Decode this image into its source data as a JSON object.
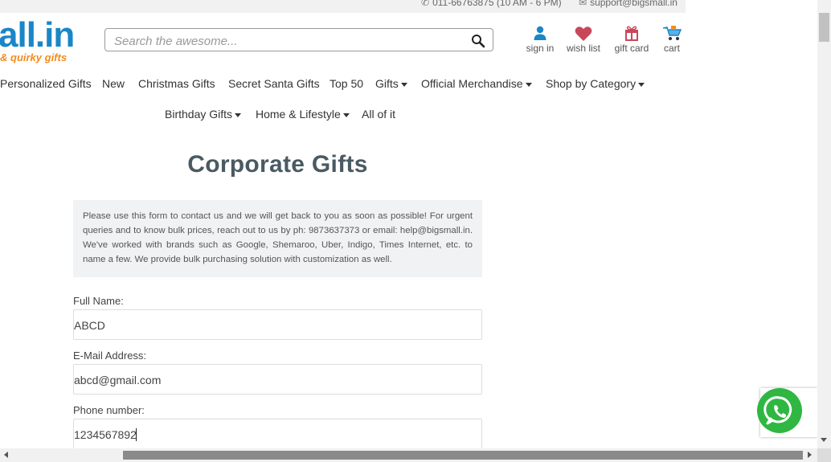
{
  "topbar": {
    "phone": "011-66763875 (10 AM - 6 PM)",
    "email": "support@bigsmall.in",
    "phone_icon": "phone-icon",
    "email_icon": "envelope-icon"
  },
  "logo": {
    "text": "all.in",
    "tagline": "& quirky gifts"
  },
  "search": {
    "placeholder": "Search the awesome...",
    "icon": "magnifier-icon"
  },
  "header_icons": [
    {
      "label": "sign in",
      "icon": "user-icon"
    },
    {
      "label": "wish list",
      "icon": "heart-icon"
    },
    {
      "label": "gift card",
      "icon": "gift-icon"
    },
    {
      "label": "cart",
      "icon": "cart-icon"
    }
  ],
  "nav": {
    "row1": [
      {
        "label": "Personalized Gifts"
      },
      {
        "label": "New"
      },
      {
        "label": "Christmas Gifts"
      },
      {
        "label": "Secret Santa Gifts"
      },
      {
        "label": "Top 50"
      },
      {
        "label": "Gifts"
      },
      {
        "label": "Official Merchandise"
      },
      {
        "label": "Shop by Category"
      }
    ],
    "row2": [
      {
        "label": "Birthday Gifts"
      },
      {
        "label": "Home & Lifestyle"
      },
      {
        "label": "All of it"
      }
    ]
  },
  "page": {
    "title": "Corporate Gifts",
    "info": "Please use this form to contact us and we will get back to you as soon as possible! For urgent queries and to know bulk prices, reach out to us by ph: 9873637373 or email: help@bigsmall.in. We've worked with brands such as Google, Shemaroo, Uber, Indigo, Times Internet, etc. to name a few. We provide bulk purchasing solution with customization as well."
  },
  "form": {
    "full_name_label": "Full Name:",
    "full_name_value": "ABCD",
    "email_label": "E-Mail Address:",
    "email_value": "abcd@gmail.com",
    "phone_label": "Phone number:",
    "phone_value": "1234567892"
  },
  "colors": {
    "brand_blue": "#1a86c8",
    "brand_orange": "#f28c1c",
    "whatsapp_green": "#2fb742",
    "title_color": "#4a5a63"
  }
}
